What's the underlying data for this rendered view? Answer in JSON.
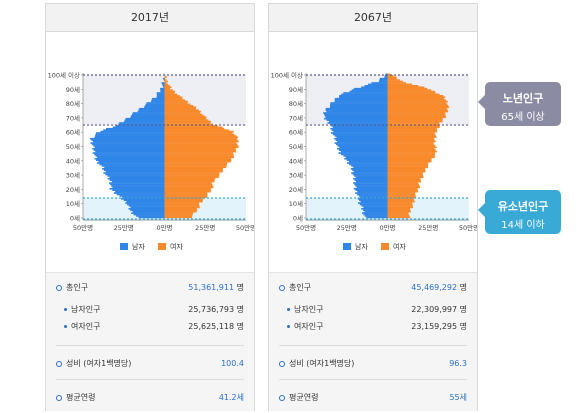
{
  "colors": {
    "male": "#2f86e8",
    "female": "#f98a2c",
    "old_band": "#eeeef5",
    "young_band": "#e2f3fb",
    "old_line": "#5a5a8a",
    "young_line": "#3aa8d8"
  },
  "legend": {
    "male": "남자",
    "female": "여자"
  },
  "callouts": {
    "old": {
      "title": "노년인구",
      "sub": "65세 이상"
    },
    "young": {
      "title": "유소년인구",
      "sub": "14세 이하"
    }
  },
  "panels": [
    {
      "year": "2017년",
      "stats": {
        "total_label": "총인구",
        "total_value": "51,361,911",
        "total_unit": "명",
        "male_label": "남자인구",
        "male_value": "25,736,793 명",
        "female_label": "여자인구",
        "female_value": "25,625,118 명",
        "ratio_label": "성비 (여자1백명당)",
        "ratio_value": "100.4",
        "age_label": "평균연령",
        "age_value": "41.2세"
      }
    },
    {
      "year": "2067년",
      "stats": {
        "total_label": "총인구",
        "total_value": "45,469,292",
        "total_unit": "명",
        "male_label": "남자인구",
        "male_value": "22,309,997 명",
        "female_label": "여자인구",
        "female_value": "23,159,295 명",
        "ratio_label": "성비 (여자1백명당)",
        "ratio_value": "96.3",
        "age_label": "평균연령",
        "age_value": "55세"
      }
    }
  ],
  "chart_data": [
    {
      "type": "area",
      "title": "2017년",
      "y_ticks": [
        "0세",
        "10세",
        "20세",
        "30세",
        "40세",
        "50세",
        "60세",
        "70세",
        "80세",
        "90세",
        "100세 이상"
      ],
      "x_ticks": [
        "50만명",
        "25만명",
        "0만명",
        "25만명",
        "50만명"
      ],
      "xlim": [
        -50,
        50
      ],
      "ylim": [
        0,
        100
      ],
      "units": "만명",
      "ages": [
        0,
        5,
        10,
        15,
        20,
        25,
        30,
        35,
        40,
        45,
        50,
        55,
        60,
        65,
        70,
        75,
        80,
        85,
        90,
        95,
        100
      ],
      "series": [
        {
          "name": "남자",
          "values": [
            17,
            21,
            23,
            28,
            33,
            33,
            36,
            38,
            42,
            43,
            44,
            45,
            40,
            28,
            22,
            16,
            10,
            5,
            2,
            0.5,
            0
          ]
        },
        {
          "name": "여자",
          "values": [
            16,
            20,
            22,
            26,
            29,
            30,
            34,
            37,
            41,
            43,
            45,
            45,
            42,
            30,
            25,
            21,
            15,
            9,
            4,
            1.5,
            0
          ]
        }
      ]
    },
    {
      "type": "area",
      "title": "2067년",
      "y_ticks": [
        "0세",
        "10세",
        "20세",
        "30세",
        "40세",
        "50세",
        "60세",
        "70세",
        "80세",
        "90세",
        "100세 이상"
      ],
      "x_ticks": [
        "50만명",
        "25만명",
        "0만명",
        "25만명",
        "50만명"
      ],
      "xlim": [
        -50,
        50
      ],
      "ylim": [
        0,
        100
      ],
      "units": "만명",
      "ages": [
        0,
        5,
        10,
        15,
        20,
        25,
        30,
        35,
        40,
        45,
        50,
        55,
        60,
        65,
        70,
        75,
        80,
        85,
        90,
        95,
        100
      ],
      "series": [
        {
          "name": "남자",
          "values": [
            14,
            15,
            17,
            18,
            20,
            20,
            21,
            22,
            25,
            29,
            31,
            32,
            34,
            35,
            39,
            38,
            34,
            30,
            20,
            6,
            1
          ]
        },
        {
          "name": "여자",
          "values": [
            13,
            14,
            16,
            17,
            19,
            20,
            22,
            24,
            27,
            30,
            29,
            29,
            30,
            32,
            35,
            37,
            37,
            34,
            25,
            9,
            2
          ]
        }
      ]
    }
  ]
}
